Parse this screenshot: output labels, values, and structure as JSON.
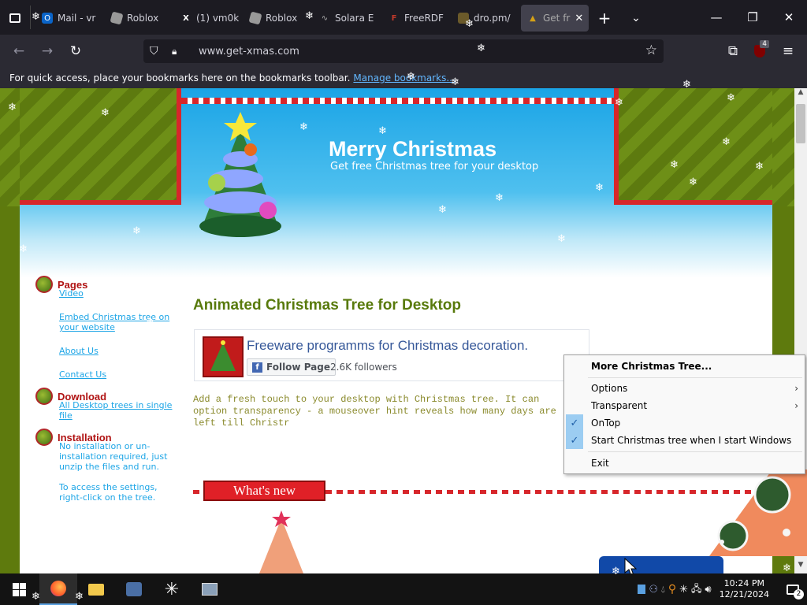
{
  "browser": {
    "tabs": [
      {
        "label": "Mail - vr",
        "icon": "outlook-icon",
        "color": "#0a64c8"
      },
      {
        "label": "Roblox",
        "icon": "roblox-icon",
        "color": "#aaaaaa"
      },
      {
        "label": "(1) vm0k",
        "icon": "x-icon",
        "color": "#000000"
      },
      {
        "label": "Roblox",
        "icon": "roblox-icon",
        "color": "#aaaaaa"
      },
      {
        "label": "Solara E",
        "icon": "solara-icon",
        "color": "#888888"
      },
      {
        "label": "FreeRDF",
        "icon": "freerdp-icon",
        "color": "#c0392b"
      },
      {
        "label": "dro.pm/",
        "icon": "dro-icon",
        "color": "#c9a227"
      },
      {
        "label": "Get fr",
        "icon": "xmas-tree-icon",
        "color": "#3a8a2c"
      }
    ],
    "url": "www.get-xmas.com",
    "extension_badge": "4",
    "bookmarks_bar": {
      "text": "For quick access, place your bookmarks here on the bookmarks toolbar.",
      "link": "Manage bookmarks..."
    }
  },
  "site": {
    "header_title": "Merry Christmas",
    "header_subtitle": "Get free Christmas tree for your desktop",
    "sidebar": [
      {
        "heading": "Pages",
        "links": [
          "Video",
          "Embed Christmas tree on your website",
          "About Us",
          "Contact Us"
        ]
      },
      {
        "heading": "Download",
        "links": [
          "All Desktop trees in single file"
        ]
      },
      {
        "heading": "Installation",
        "text": [
          "No installation or un-installation required, just unzip the files and run.",
          "To access the settings, right-click on the tree."
        ]
      }
    ],
    "main_title": "Animated Christmas Tree for Desktop",
    "facebook": {
      "page_name": "Freeware programms for Christmas decoration.",
      "follow_button": "Follow Page",
      "followers": "2.6K followers"
    },
    "description": "Add a fresh touch to your desktop with Christmas tree. It can option transparency - a mouseover hint reveals how many days are left till Christr",
    "whats_new": "What's new"
  },
  "context_menu": {
    "items": [
      {
        "label": "More Christmas Tree...",
        "bold": true
      },
      {
        "label": "Options",
        "submenu": true
      },
      {
        "label": "Transparent",
        "submenu": true
      },
      {
        "label": "OnTop",
        "checked": true
      },
      {
        "label": "Start Christmas tree when I start Windows",
        "checked": true
      },
      {
        "label": "Exit"
      }
    ]
  },
  "taskbar": {
    "time": "10:24 PM",
    "date": "12/21/2024",
    "notifications": "2"
  },
  "colors": {
    "accent_blue": "#1da5e6",
    "header_red": "#b01212",
    "title_green": "#587a0c"
  }
}
